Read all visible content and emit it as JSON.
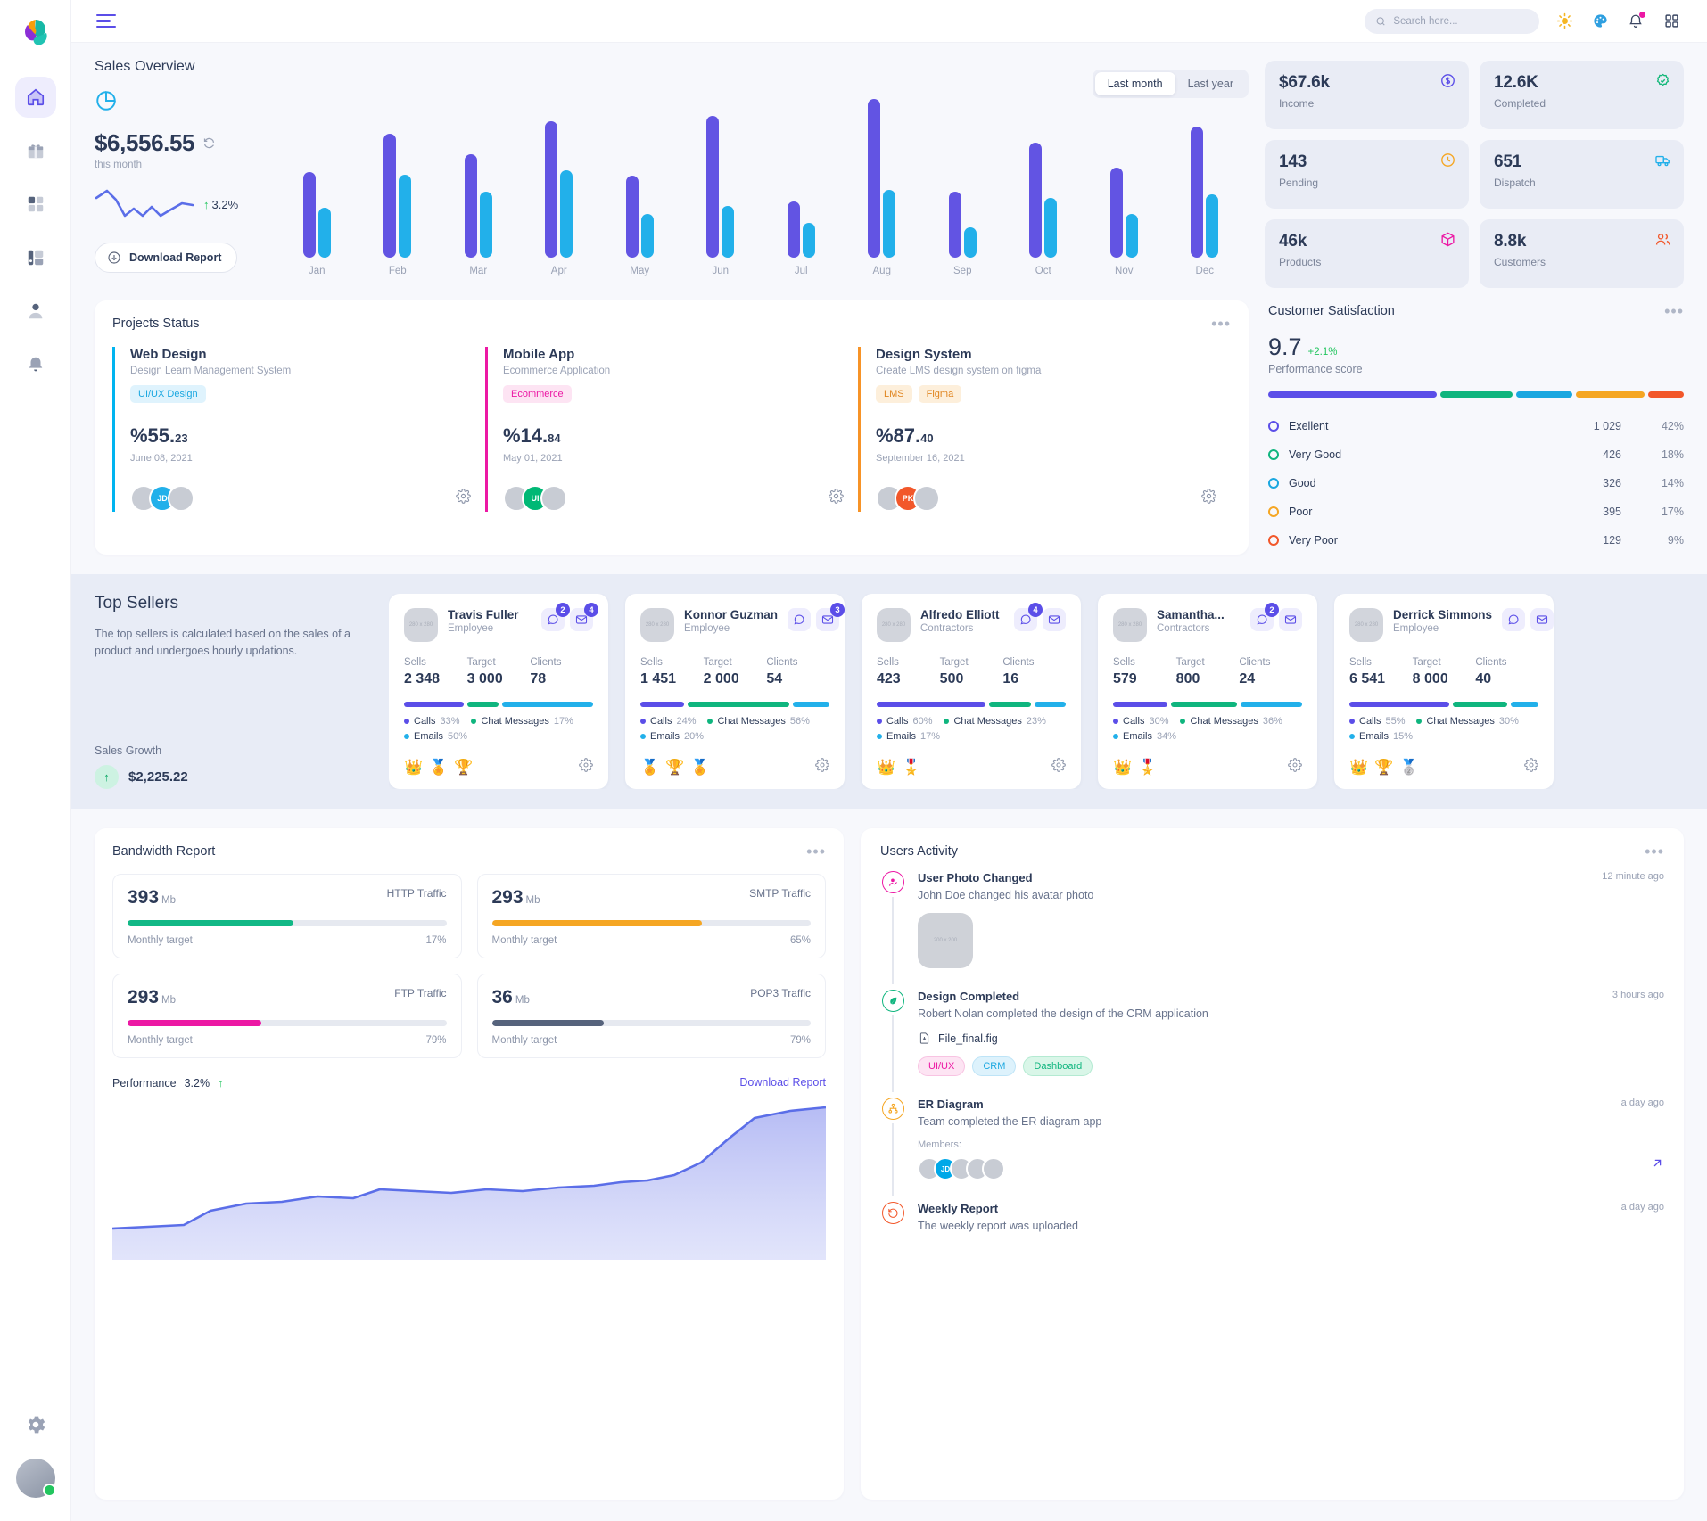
{
  "topbar": {
    "menu_icon": "hamburger-icon",
    "search_placeholder": "Search here...",
    "icons": [
      "sun-icon",
      "palette-icon",
      "bell-icon",
      "grid-apps-icon"
    ]
  },
  "sidebar": {
    "items": [
      {
        "name": "home",
        "icon": "home-icon",
        "active": true
      },
      {
        "name": "gifts",
        "icon": "gift-icon",
        "active": false
      },
      {
        "name": "apps",
        "icon": "grid-icon",
        "active": false
      },
      {
        "name": "charts",
        "icon": "chart-icon",
        "active": false
      },
      {
        "name": "users",
        "icon": "users-icon",
        "active": false
      },
      {
        "name": "alerts",
        "icon": "bell-alert-icon",
        "active": false
      }
    ],
    "bottom": [
      {
        "name": "settings",
        "icon": "gear-icon"
      },
      {
        "name": "profile",
        "icon": "avatar"
      }
    ]
  },
  "sales": {
    "title": "Sales Overview",
    "amount": "$6,556.55",
    "amount_sub": "this month",
    "refresh_icon": "refresh-icon",
    "pie_icon": "pie-chart-icon",
    "growth": "3.2%",
    "growth_arrow": "↑",
    "download_label": "Download Report",
    "download_icon": "download-circle-icon",
    "toggle": [
      {
        "label": "Last month",
        "active": true
      },
      {
        "label": "Last year",
        "active": false
      }
    ]
  },
  "chart_data": {
    "type": "bar",
    "title": "Sales Overview",
    "categories": [
      "Jan",
      "Feb",
      "Mar",
      "Apr",
      "May",
      "Jun",
      "Jul",
      "Aug",
      "Sep",
      "Oct",
      "Nov",
      "Dec"
    ],
    "series": [
      {
        "name": "Last month",
        "color": "#6254e3",
        "values": [
          78,
          113,
          95,
          125,
          75,
          130,
          51,
          145,
          60,
          105,
          82,
          120
        ]
      },
      {
        "name": "Last year",
        "color": "#22b0ea",
        "values": [
          46,
          76,
          60,
          80,
          40,
          47,
          32,
          62,
          28,
          55,
          40,
          58
        ]
      }
    ],
    "ylabel": "",
    "xlabel": "",
    "grid": false,
    "legend": "none"
  },
  "stats": [
    {
      "value": "$67.6k",
      "label": "Income",
      "icon": "dollar-badge-icon",
      "color": "#5b4ee8"
    },
    {
      "value": "12.6K",
      "label": "Completed",
      "icon": "check-badge-icon",
      "color": "#14b87a"
    },
    {
      "value": "143",
      "label": "Pending",
      "icon": "clock-icon",
      "color": "#f5a623"
    },
    {
      "value": "651",
      "label": "Dispatch",
      "icon": "truck-icon",
      "color": "#22b0ea"
    },
    {
      "value": "46k",
      "label": "Products",
      "icon": "box-icon",
      "color": "#ec18a4"
    },
    {
      "value": "8.8k",
      "label": "Customers",
      "icon": "people-icon",
      "color": "#f2572a"
    }
  ],
  "projects": {
    "title": "Projects Status",
    "menu_icon": "more-dots-icon",
    "items": [
      {
        "name": "Web Design",
        "sub": "Design Learn Management System",
        "accent": "#00b4f0",
        "tags": [
          {
            "text": "UI/UX Design",
            "bg": "#dff3fd",
            "fg": "#1aa7e0"
          }
        ],
        "pct": "%55.",
        "pct_dec": "23",
        "date": "June 08, 2021",
        "avatars": [
          {
            "t": "",
            "bg": "#c8ccd4"
          },
          {
            "t": "JD",
            "bg": "#22b0ea"
          },
          {
            "t": "",
            "bg": "#c8ccd4"
          }
        ],
        "gear_icon": "gear-icon"
      },
      {
        "name": "Mobile App",
        "sub": "Ecommerce Application",
        "accent": "#ec18a4",
        "tags": [
          {
            "text": "Ecommerce",
            "bg": "#fde4f3",
            "fg": "#ec18a4"
          }
        ],
        "pct": "%14.",
        "pct_dec": "84",
        "date": "May 01, 2021",
        "avatars": [
          {
            "t": "",
            "bg": "#c8ccd4"
          },
          {
            "t": "UI",
            "bg": "#00b875"
          },
          {
            "t": "",
            "bg": "#c8ccd4"
          }
        ],
        "gear_icon": "gear-icon"
      },
      {
        "name": "Design System",
        "sub": "Create LMS design system on figma",
        "accent": "#f79327",
        "tags": [
          {
            "text": "LMS",
            "bg": "#fdefdb",
            "fg": "#e08520"
          },
          {
            "text": "Figma",
            "bg": "#fdefdb",
            "fg": "#e08520"
          }
        ],
        "pct": "%87.",
        "pct_dec": "40",
        "date": "September 16, 2021",
        "avatars": [
          {
            "t": "",
            "bg": "#c8ccd4"
          },
          {
            "t": "PK",
            "bg": "#f2572a"
          },
          {
            "t": "",
            "bg": "#c8ccd4"
          }
        ],
        "gear_icon": "gear-icon"
      }
    ]
  },
  "satisfaction": {
    "title": "Customer Satisfaction",
    "menu_icon": "more-dots-icon",
    "score": "9.7",
    "delta": "+2.1%",
    "score_label": "Performance score",
    "segments": [
      {
        "color": "#5b4ee8",
        "pct": 42
      },
      {
        "color": "#0fb57e",
        "pct": 18
      },
      {
        "color": "#1aa7e0",
        "pct": 14
      },
      {
        "color": "#f5a623",
        "pct": 17
      },
      {
        "color": "#f2572a",
        "pct": 9
      }
    ],
    "rows": [
      {
        "label": "Exellent",
        "count": "1 029",
        "pct": "42%",
        "color": "#5b4ee8"
      },
      {
        "label": "Very Good",
        "count": "426",
        "pct": "18%",
        "color": "#0fb57e"
      },
      {
        "label": "Good",
        "count": "326",
        "pct": "14%",
        "color": "#1aa7e0"
      },
      {
        "label": "Poor",
        "count": "395",
        "pct": "17%",
        "color": "#f5a623"
      },
      {
        "label": "Very Poor",
        "count": "129",
        "pct": "9%",
        "color": "#f2572a"
      }
    ]
  },
  "top_sellers": {
    "title": "Top Sellers",
    "description": "The top sellers is calculated based on the sales of a product and undergoes hourly updations.",
    "growth_label": "Sales Growth",
    "growth_value": "$2,225.22",
    "growth_arrow": "↑",
    "headers": {
      "sells": "Sells",
      "target": "Target",
      "clients": "Clients"
    },
    "legend_labels": {
      "calls": "Calls",
      "chat": "Chat Messages",
      "emails": "Emails"
    },
    "cards": [
      {
        "name": "Travis Fuller",
        "role": "Employee",
        "chat_badge": "2",
        "mail_badge": "4",
        "sells": "2 348",
        "target": "3 000",
        "clients": "78",
        "calls": "33%",
        "chat": "17%",
        "emails": "50%",
        "bar": [
          33,
          17,
          50
        ],
        "medals": [
          "👑",
          "🏅",
          "🏆"
        ]
      },
      {
        "name": "Konnor Guzman",
        "role": "Employee",
        "chat_badge": "",
        "mail_badge": "3",
        "sells": "1 451",
        "target": "2 000",
        "clients": "54",
        "calls": "24%",
        "chat": "56%",
        "emails": "20%",
        "bar": [
          24,
          56,
          20
        ],
        "medals": [
          "🏅",
          "🏆",
          "🏅"
        ]
      },
      {
        "name": "Alfredo Elliott",
        "role": "Contractors",
        "chat_badge": "4",
        "mail_badge": "",
        "sells": "423",
        "target": "500",
        "clients": "16",
        "calls": "60%",
        "chat": "23%",
        "emails": "17%",
        "bar": [
          60,
          23,
          17
        ],
        "medals": [
          "👑",
          "🎖️"
        ]
      },
      {
        "name": "Samantha...",
        "role": "Contractors",
        "chat_badge": "2",
        "mail_badge": "",
        "sells": "579",
        "target": "800",
        "clients": "24",
        "calls": "30%",
        "chat": "36%",
        "emails": "34%",
        "bar": [
          30,
          36,
          34
        ],
        "medals": [
          "👑",
          "🎖️"
        ]
      },
      {
        "name": "Derrick Simmons",
        "role": "Employee",
        "chat_badge": "",
        "mail_badge": "",
        "sells": "6 541",
        "target": "8 000",
        "clients": "40",
        "calls": "55%",
        "chat": "30%",
        "emails": "15%",
        "bar": [
          55,
          30,
          15
        ],
        "medals": [
          "👑",
          "🏆",
          "🥈"
        ]
      }
    ]
  },
  "bandwidth": {
    "title": "Bandwidth Report",
    "menu_icon": "more-dots-icon",
    "target_label": "Monthly target",
    "cards": [
      {
        "num": "393",
        "unit": "Mb",
        "kind": "HTTP Traffic",
        "pct": "17%",
        "fill": 52,
        "color": "#12b886"
      },
      {
        "num": "293",
        "unit": "Mb",
        "kind": "SMTP Traffic",
        "pct": "65%",
        "fill": 66,
        "color": "#f5a623"
      },
      {
        "num": "293",
        "unit": "Mb",
        "kind": "FTP Traffic",
        "pct": "79%",
        "fill": 42,
        "color": "#ec18a4"
      },
      {
        "num": "36",
        "unit": "Mb",
        "kind": "POP3 Traffic",
        "pct": "79%",
        "fill": 35,
        "color": "#56637c"
      }
    ],
    "perf_label": "Performance",
    "perf_value": "3.2%",
    "perf_arrow": "↑",
    "download_label": "Download Report"
  },
  "activity": {
    "title": "Users Activity",
    "menu_icon": "more-dots-icon",
    "items": [
      {
        "title": "User Photo Changed",
        "desc": "John Doe changed his avatar photo",
        "time": "12 minute ago",
        "icon": "user-edit-icon",
        "color": "#ec18a4",
        "photo": "200 x 200"
      },
      {
        "title": "Design Completed",
        "desc": "Robert Nolan completed the design of the CRM application",
        "time": "3 hours ago",
        "icon": "leaf-check-icon",
        "color": "#0fb57e",
        "file": "File_final.fig",
        "file_icon": "file-download-icon",
        "tags": [
          {
            "text": "UI/UX",
            "bg": "#fde4f3",
            "fg": "#ec18a4",
            "bd": "#f8c3e2"
          },
          {
            "text": "CRM",
            "bg": "#ddf2fc",
            "fg": "#1aa7e0",
            "bd": "#bee4f7"
          },
          {
            "text": "Dashboard",
            "bg": "#d9f6e8",
            "fg": "#0fb57e",
            "bd": "#b4ead2"
          }
        ]
      },
      {
        "title": "ER Diagram",
        "desc": "Team completed the ER diagram app",
        "time": "a day ago",
        "icon": "sitemap-icon",
        "color": "#f5a623",
        "members_label": "Members:",
        "members": [
          {
            "t": "",
            "bg": "#c8ccd4"
          },
          {
            "t": "JD",
            "bg": "#00a8e8"
          },
          {
            "t": "",
            "bg": "#c8ccd4"
          },
          {
            "t": "",
            "bg": "#c8ccd4"
          },
          {
            "t": "",
            "bg": "#c8ccd4"
          }
        ],
        "open_icon": "arrow-up-right-icon"
      },
      {
        "title": "Weekly Report",
        "desc": "The weekly report was uploaded",
        "time": "a day ago",
        "icon": "history-icon",
        "color": "#f2572a"
      }
    ]
  }
}
